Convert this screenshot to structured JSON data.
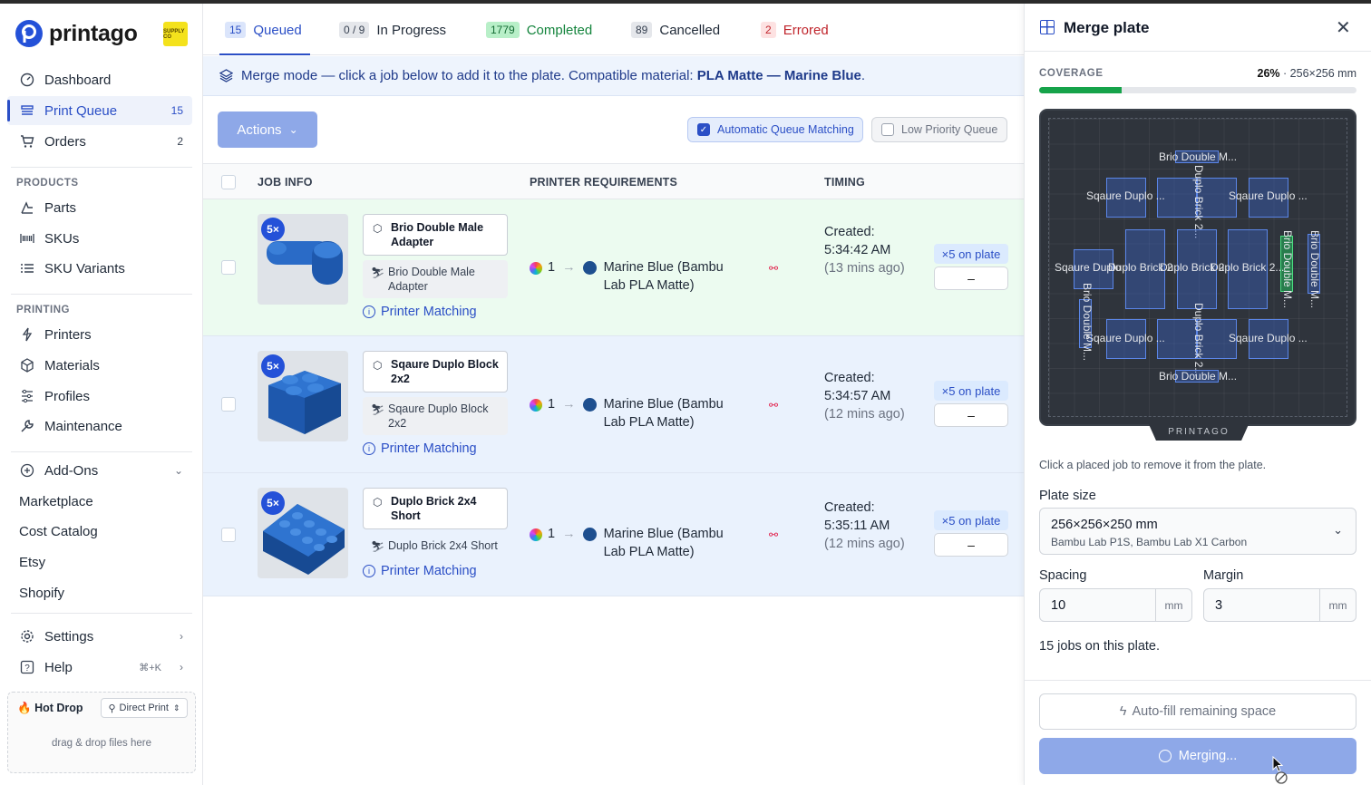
{
  "brand": {
    "name": "printago",
    "badge_text": "SUPPLY CO",
    "logo_color": "#2451d8"
  },
  "sidebar": {
    "main_items": [
      {
        "label": "Dashboard",
        "icon": "dashboard-icon"
      },
      {
        "label": "Print Queue",
        "count": "15",
        "icon": "queue-icon",
        "active": true
      },
      {
        "label": "Orders",
        "count": "2",
        "icon": "cart-icon"
      }
    ],
    "products_label": "PRODUCTS",
    "products_items": [
      {
        "label": "Parts",
        "icon": "parts-icon"
      },
      {
        "label": "SKUs",
        "icon": "barcode-icon"
      },
      {
        "label": "SKU Variants",
        "icon": "list-icon"
      }
    ],
    "printing_label": "PRINTING",
    "printing_items": [
      {
        "label": "Printers",
        "icon": "printer-icon"
      },
      {
        "label": "Materials",
        "icon": "cube-icon"
      },
      {
        "label": "Profiles",
        "icon": "sliders-icon"
      },
      {
        "label": "Maintenance",
        "icon": "wrench-icon"
      }
    ],
    "addons_label": "Add-Ons",
    "addons_items": [
      "Marketplace",
      "Cost Catalog",
      "Etsy",
      "Shopify"
    ],
    "settings_label": "Settings",
    "help_label": "Help",
    "help_shortcut": "⌘+K",
    "hotdrop": {
      "title": "Hot Drop",
      "mode": "Direct Print",
      "hint": "drag & drop files here"
    }
  },
  "tabs": [
    {
      "count": "15",
      "label": "Queued"
    },
    {
      "count": "0 / 9",
      "label": "In Progress"
    },
    {
      "count": "1779",
      "label": "Completed"
    },
    {
      "count": "89",
      "label": "Cancelled"
    },
    {
      "count": "2",
      "label": "Errored"
    }
  ],
  "banner": {
    "text": "Merge mode — click a job below to add it to the plate. Compatible material:",
    "material": "PLA Matte — Marine Blue",
    "period": "."
  },
  "toolbar": {
    "actions_label": "Actions",
    "auto_match_label": "Automatic Queue Matching",
    "low_priority_label": "Low Priority Queue"
  },
  "table": {
    "headers": {
      "job": "JOB INFO",
      "printer": "PRINTER REQUIREMENTS",
      "timing": "TIMING"
    },
    "rows": [
      {
        "qty": "5×",
        "name": "Brio Double Male Adapter",
        "part": "Brio Double Male Adapter",
        "link": "Printer Matching",
        "req_count": "1",
        "material": "Marine Blue (Bambu Lab PLA Matte)",
        "created_label": "Created:",
        "created": "5:34:42 AM",
        "ago": "(13 mins ago)",
        "onplate": "×5 on plate",
        "minus": "–"
      },
      {
        "qty": "5×",
        "name": "Sqaure Duplo Block 2x2",
        "part": "Sqaure Duplo Block 2x2",
        "link": "Printer Matching",
        "req_count": "1",
        "material": "Marine Blue (Bambu Lab PLA Matte)",
        "created_label": "Created:",
        "created": "5:34:57 AM",
        "ago": "(12 mins ago)",
        "onplate": "×5 on plate",
        "minus": "–"
      },
      {
        "qty": "5×",
        "name": "Duplo Brick 2x4 Short",
        "part": "Duplo Brick 2x4 Short",
        "link": "Printer Matching",
        "req_count": "1",
        "material": "Marine Blue (Bambu Lab PLA Matte)",
        "created_label": "Created:",
        "created": "5:35:11 AM",
        "ago": "(12 mins ago)",
        "onplate": "×5 on plate",
        "minus": "–"
      }
    ]
  },
  "panel": {
    "title": "Merge plate",
    "coverage_label": "COVERAGE",
    "coverage_pct": "26%",
    "coverage_fraction": 0.26,
    "coverage_size": "· 256×256 mm",
    "plate_brand": "PRINTAGO",
    "plate_labels": {
      "brio": "Brio Double M...",
      "square": "Sqaure Duplo ...",
      "square_short": "Sqaure Duplo",
      "duplo": "Duplo Brick 2...",
      "duplo_short": "Duplo Brick 2",
      "duplo_mid": "Duplo Brick 2..."
    },
    "hint": "Click a placed job to remove it from the plate.",
    "plate_size_label": "Plate size",
    "plate_size_value": "256×256×250 mm",
    "plate_size_printers": "Bambu Lab P1S, Bambu Lab X1 Carbon",
    "spacing_label": "Spacing",
    "spacing_value": "10",
    "margin_label": "Margin",
    "margin_value": "3",
    "unit": "mm",
    "jobs_on_plate": "15 jobs on this plate.",
    "autofill_label": "Auto-fill remaining space",
    "merge_label": "Merging..."
  },
  "colors": {
    "accent": "#2b4fc6",
    "success": "#16a34a",
    "error": "#c0262d",
    "material": "#1e4f8f"
  }
}
